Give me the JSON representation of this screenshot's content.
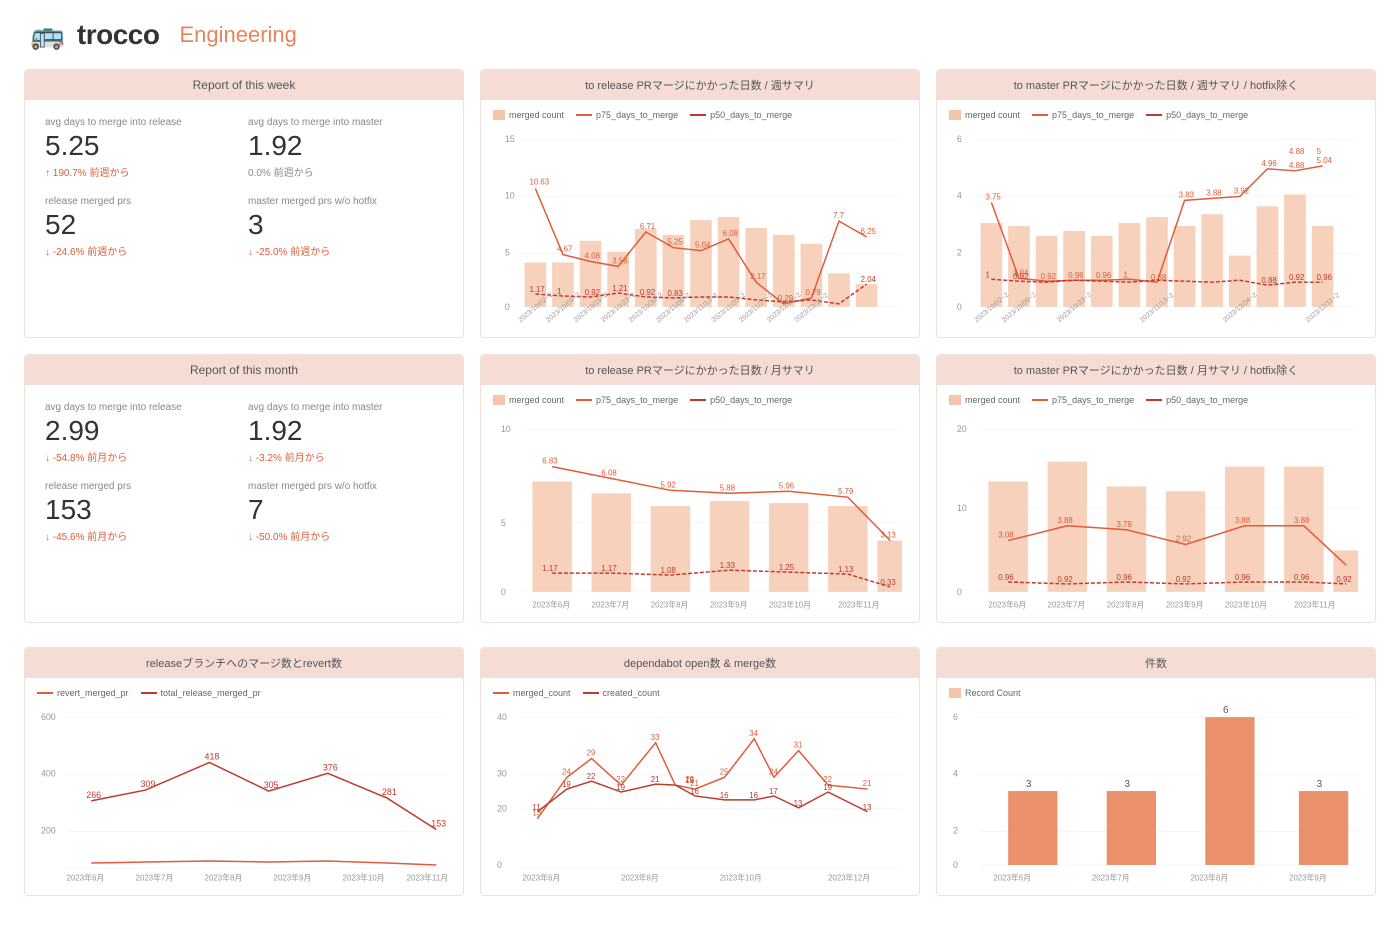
{
  "header": {
    "logo_icon": "🚌",
    "logo_text": "trocco",
    "logo_sub": "Engineering"
  },
  "week_report": {
    "title": "Report of this week",
    "stat1_label": "avg days to merge into release",
    "stat1_value": "5.25",
    "stat1_change": "↑ 190.7% 前週から",
    "stat1_change_type": "down",
    "stat2_label": "avg days to merge into master",
    "stat2_value": "1.92",
    "stat2_change": "0.0% 前週から",
    "stat2_change_type": "neutral",
    "stat3_label": "release merged prs",
    "stat3_value": "52",
    "stat3_change": "↓ -24.6% 前週から",
    "stat3_change_type": "down",
    "stat4_label": "master merged prs w/o hotfix",
    "stat4_value": "3",
    "stat4_change": "↓ -25.0% 前週から",
    "stat4_change_type": "down"
  },
  "month_report": {
    "title": "Report of this month",
    "stat1_label": "avg days to merge into release",
    "stat1_value": "2.99",
    "stat1_change": "↓ -54.8% 前月から",
    "stat1_change_type": "down",
    "stat2_label": "avg days to merge into master",
    "stat2_value": "1.92",
    "stat2_change": "↓ -3.2% 前月から",
    "stat2_change_type": "down",
    "stat3_label": "release merged prs",
    "stat3_value": "153",
    "stat3_change": "↓ -45.6% 前月から",
    "stat3_change_type": "down",
    "stat4_label": "master merged prs w/o hotfix",
    "stat4_value": "7",
    "stat4_change": "↓ -50.0% 前月から",
    "stat4_change_type": "down"
  },
  "chart_release_week": {
    "title": "to release PRマージにかかった日数 / 週サマリ",
    "legend": [
      "merged count",
      "p75_days_to_merge",
      "p50_days_to_merge"
    ]
  },
  "chart_master_week": {
    "title": "to master PRマージにかかった日数 / 週サマリ / hotfix除く",
    "legend": [
      "merged count",
      "p75_days_to_merge",
      "p50_days_to_merge"
    ]
  },
  "chart_release_month": {
    "title": "to release PRマージにかかった日数 / 月サマリ",
    "legend": [
      "merged count",
      "p75_days_to_merge",
      "p50_days_to_merge"
    ]
  },
  "chart_master_month": {
    "title": "to master PRマージにかかった日数 / 月サマリ / hotfix除く",
    "legend": [
      "merged count",
      "p75_days_to_merge",
      "p50_days_to_merge"
    ]
  },
  "chart_release_revert": {
    "title": "releaseブランチへのマージ数とrevert数",
    "legend": [
      "revert_merged_pr",
      "total_release_merged_pr"
    ]
  },
  "chart_dependabot": {
    "title": "dependabot open数 & merge数",
    "legend": [
      "merged_count",
      "created_count"
    ]
  },
  "chart_kensu": {
    "title": "件数",
    "legend": [
      "Record Count"
    ]
  }
}
